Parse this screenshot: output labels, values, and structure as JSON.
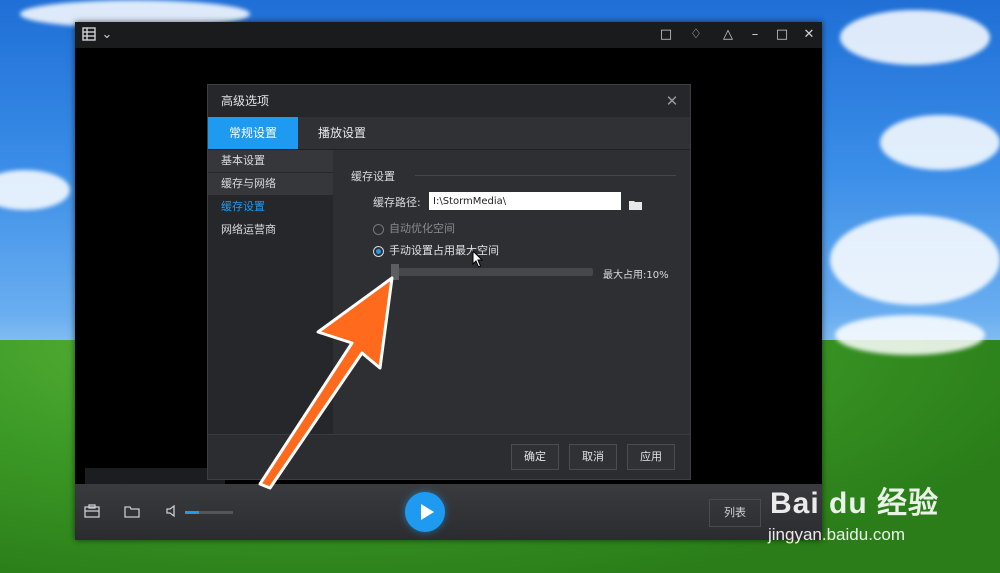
{
  "dialog": {
    "title": "高级选项",
    "close_icon": "close-icon",
    "tabs": [
      {
        "label": "常规设置",
        "active": true
      },
      {
        "label": "播放设置",
        "active": false
      }
    ],
    "sidebar": [
      {
        "label": "基本设置"
      },
      {
        "label": "缓存与网络"
      },
      {
        "label": "缓存设置"
      },
      {
        "label": "网络运营商"
      }
    ],
    "section_title": "缓存设置",
    "path_label": "缓存路径:",
    "path_value": "I:\\StormMedia\\",
    "radio_auto": "自动优化空间",
    "radio_manual": "手动设置占用最大空间",
    "slider_value_label": "最大占用:10%",
    "slider_fraction": 0.1,
    "buttons": {
      "ok": "确定",
      "cancel": "取消",
      "apply": "应用"
    }
  },
  "player": {
    "list_button": "列表",
    "volume_level": 0.3,
    "accent": "#1e9bf0"
  },
  "watermark": {
    "main": "Bai du 经验",
    "sub": "jingyan.baidu.com"
  }
}
